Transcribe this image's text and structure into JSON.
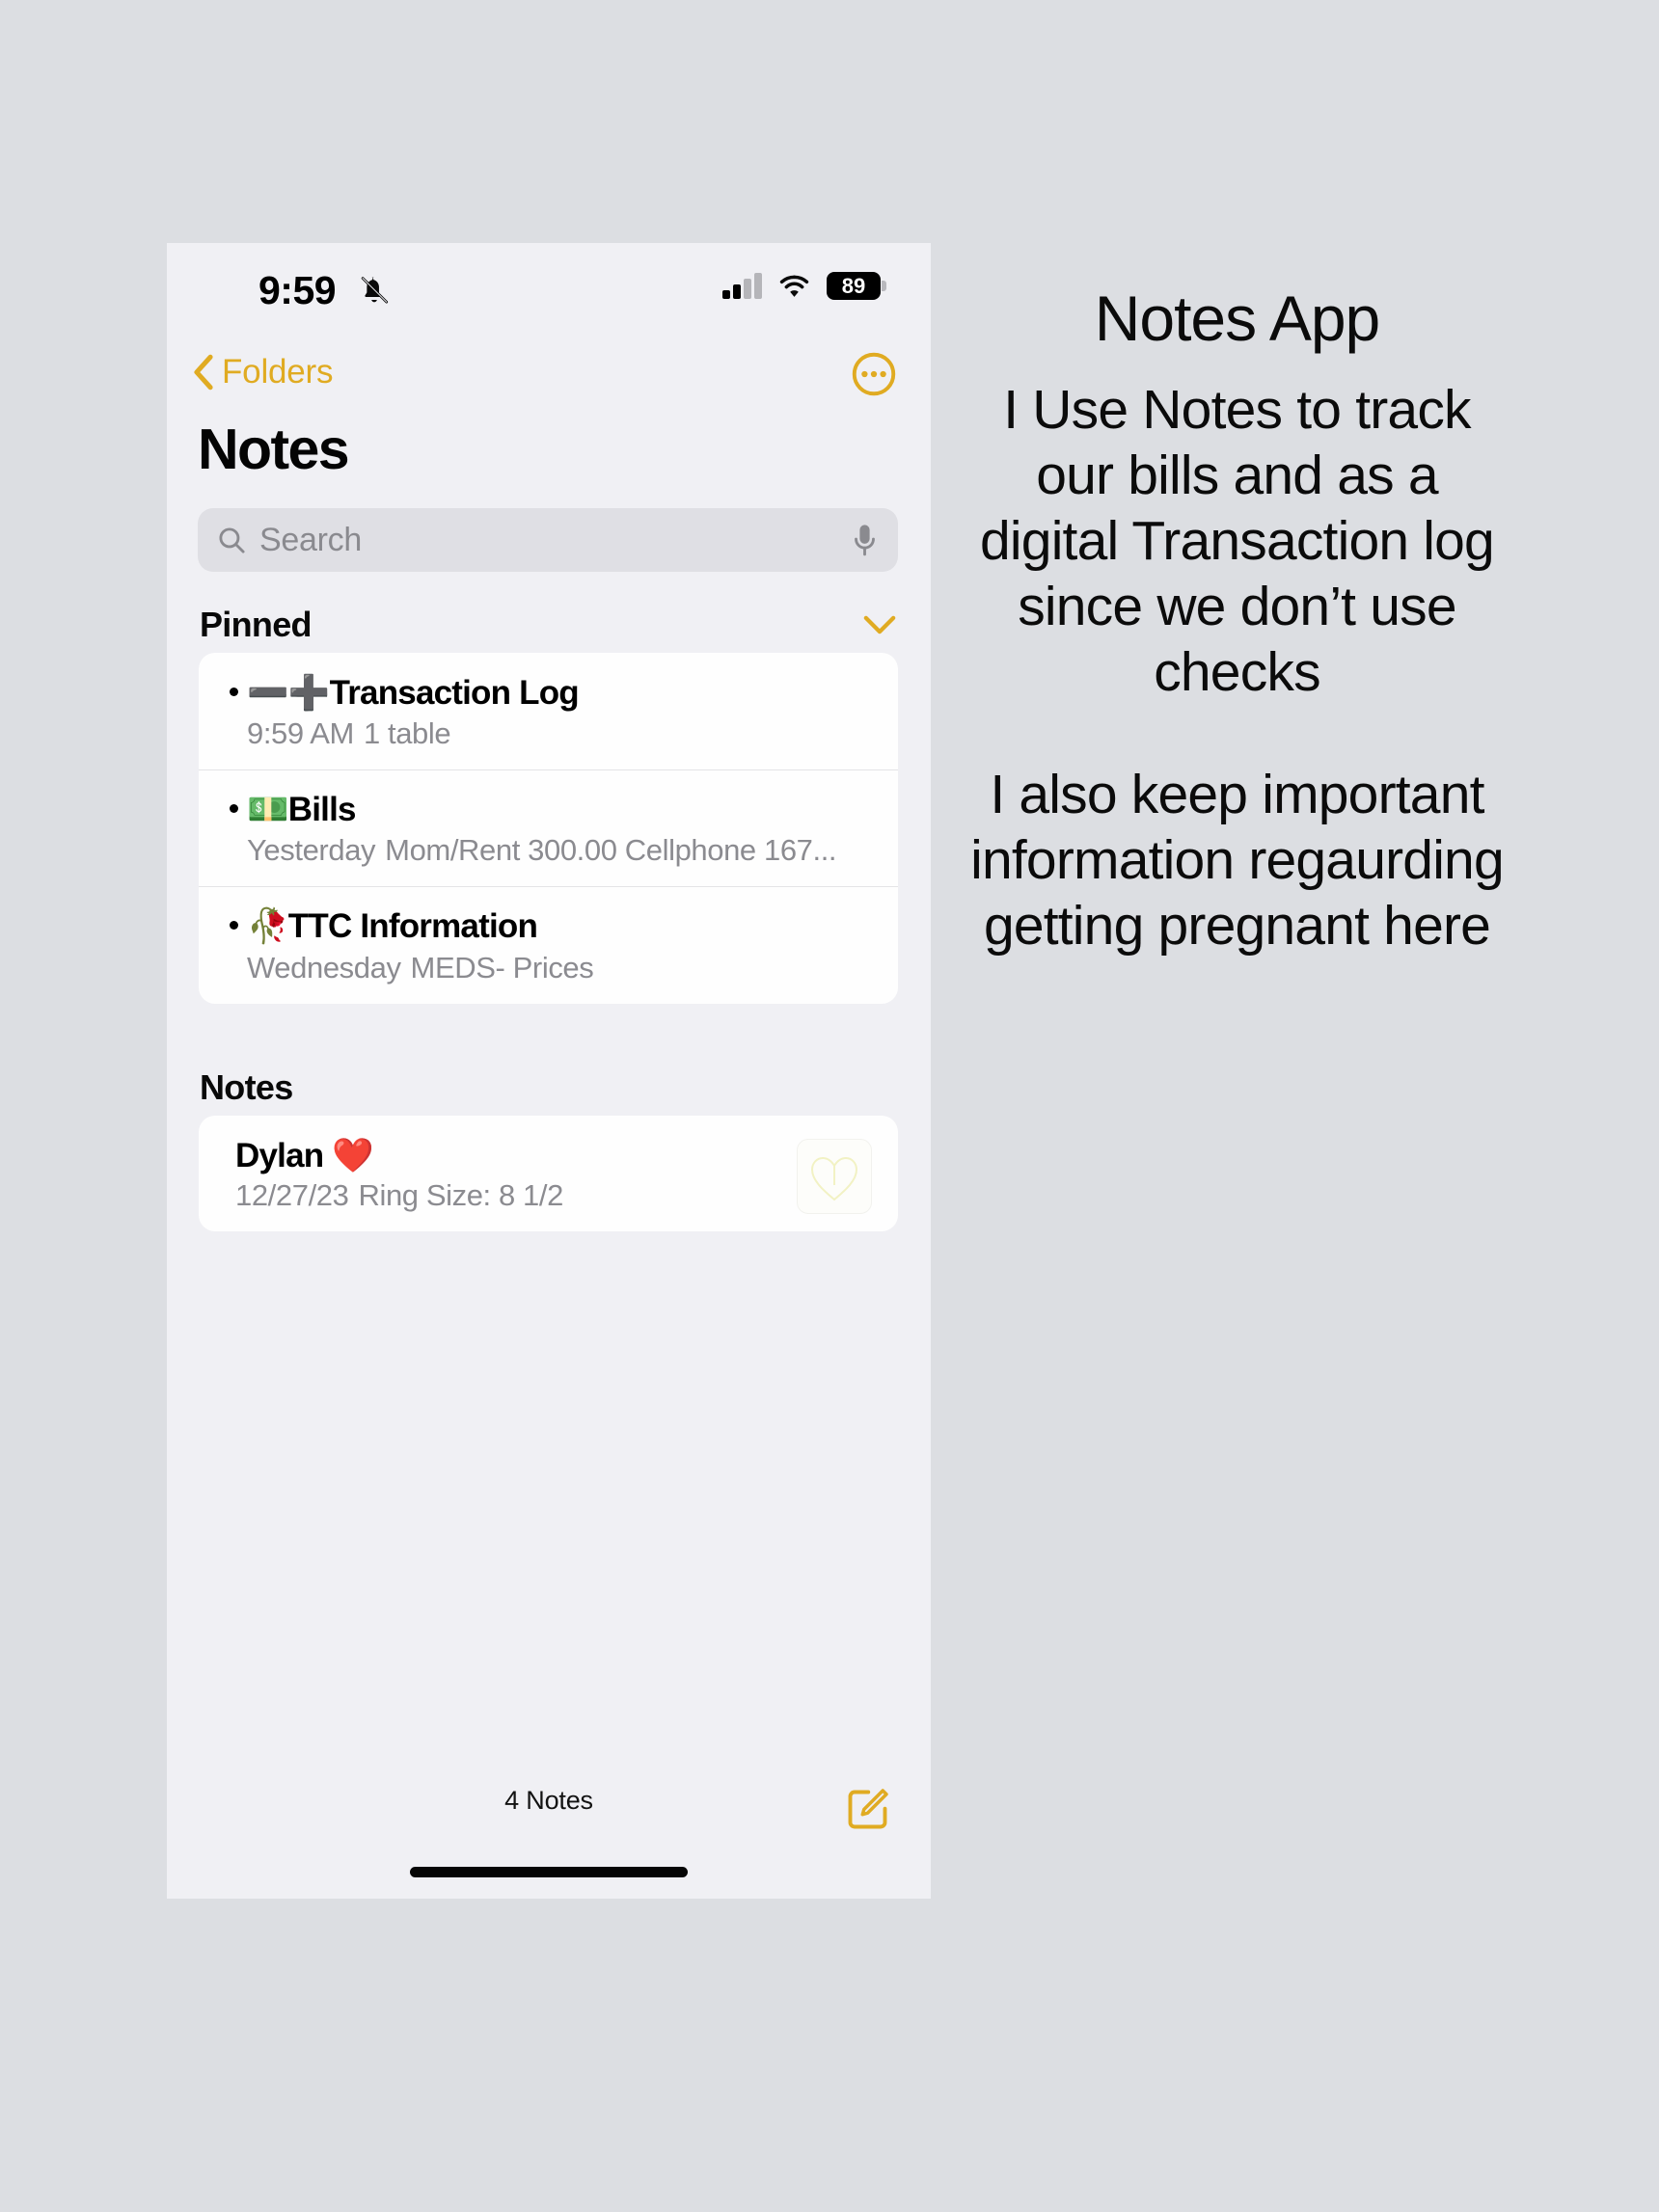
{
  "colors": {
    "accent": "#e0ab22",
    "page_background": "#dcdee2",
    "phone_background": "#f0f0f4",
    "card_background": "#fefefe",
    "secondary_text": "#8b8b90"
  },
  "phone": {
    "status_bar": {
      "time": "9:59",
      "silent_icon": "bell-slash-icon",
      "cellular_icon": "cellular-signal-icon",
      "wifi_icon": "wifi-icon",
      "battery_percent": "89"
    },
    "nav_bar": {
      "back_icon": "chevron-left-icon",
      "back_label": "Folders",
      "more_icon": "more-circle-icon"
    },
    "page_title": "Notes",
    "search": {
      "icon": "search-icon",
      "placeholder": "Search",
      "value": "",
      "mic_icon": "microphone-icon"
    },
    "sections": [
      {
        "title": "Pinned",
        "collapse_icon": "chevron-down-icon",
        "notes": [
          {
            "emoji": "➖➕",
            "title": "Transaction Log",
            "date": "9:59 AM",
            "snippet": "1 table",
            "has_bullet": true,
            "thumbnail": false
          },
          {
            "emoji": "💵",
            "title": "Bills",
            "date": "Yesterday",
            "snippet": "Mom/Rent 300.00 Cellphone 167...",
            "has_bullet": true,
            "thumbnail": false
          },
          {
            "emoji": "🥀",
            "title": "TTC Information",
            "date": "Wednesday",
            "snippet": "MEDS- Prices",
            "has_bullet": true,
            "thumbnail": false
          }
        ]
      },
      {
        "title": "Notes",
        "collapse_icon": "",
        "notes": [
          {
            "emoji": "",
            "title": "Dylan ❤️",
            "date": "12/27/23",
            "snippet": "Ring Size: 8 1/2",
            "has_bullet": false,
            "thumbnail": true
          }
        ]
      }
    ],
    "toolbar": {
      "count_label": "4 Notes",
      "compose_icon": "compose-icon"
    }
  },
  "caption": {
    "heading": "Notes App",
    "paragraph1": "I Use Notes to track our bills and as a digital Transaction log since we don’t use checks",
    "paragraph2": "I also keep important information regaurding getting pregnant here"
  }
}
